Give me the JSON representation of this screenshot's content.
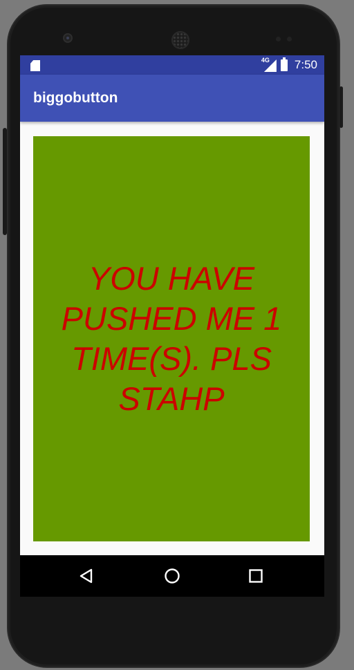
{
  "status_bar": {
    "network_type": "4G",
    "time": "7:50",
    "icons": [
      "sd-card-icon",
      "signal-icon",
      "battery-icon"
    ]
  },
  "app_bar": {
    "title": "biggobutton",
    "color": "#3f51b5"
  },
  "big_button": {
    "label": "YOU HAVE PUSHED ME 1 TIME(S). PLS STAHP",
    "background_color": "#669900",
    "text_color": "#cc0000"
  },
  "nav_bar": {
    "items": [
      "back-icon",
      "home-icon",
      "recents-icon"
    ]
  }
}
